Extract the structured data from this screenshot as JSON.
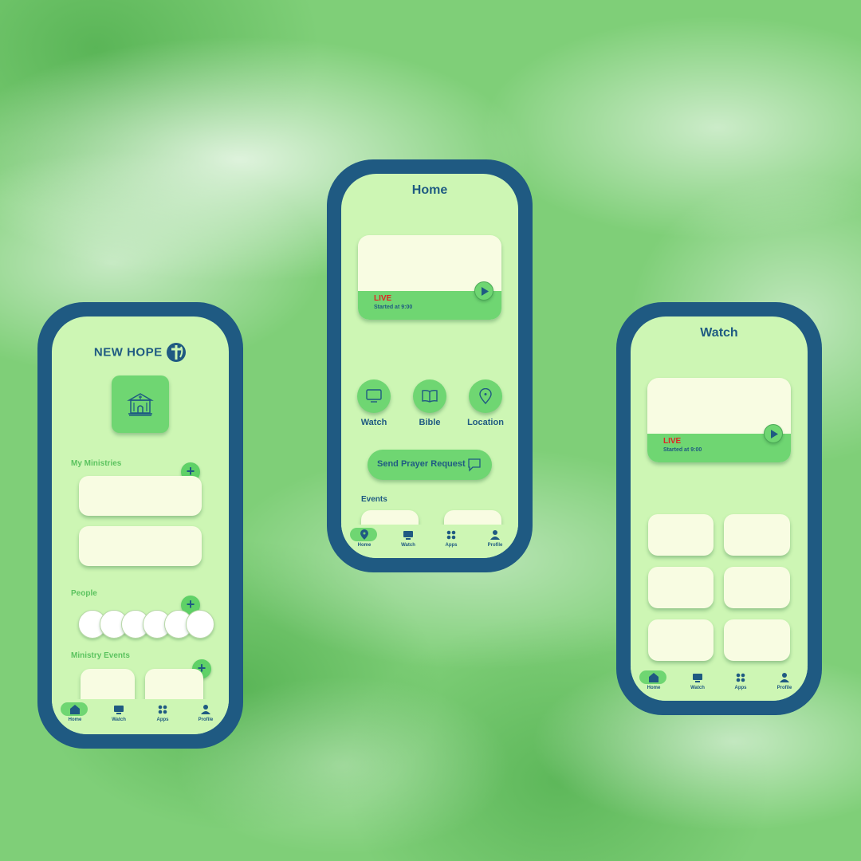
{
  "left_phone": {
    "brand": "NEW HOPE",
    "sections": {
      "ministries": "My Ministries",
      "people": "People",
      "events": "Ministry Events"
    },
    "add_symbol": "+",
    "tabs": [
      "Home",
      "Watch",
      "Apps",
      "Profile"
    ],
    "active_tab": "Home"
  },
  "center_phone": {
    "title": "Home",
    "live": {
      "label": "LIVE",
      "started": "Started at 9:00"
    },
    "shortcuts": [
      "Watch",
      "Bible",
      "Location"
    ],
    "prayer_button": "Send Prayer Request",
    "events_label": "Events",
    "tabs": [
      "Home",
      "Watch",
      "Apps",
      "Profile"
    ],
    "active_tab": "Home"
  },
  "right_phone": {
    "title": "Watch",
    "live": {
      "label": "LIVE",
      "started": "Started at 9:00"
    },
    "tabs": [
      "Home",
      "Watch",
      "Apps",
      "Profile"
    ],
    "active_tab": "Home"
  },
  "colors": {
    "frame": "#1f5a82",
    "screen": "#cdf6b4",
    "accent_green": "#6fd672",
    "card": "#f8fce2",
    "live_red": "#e02424"
  }
}
